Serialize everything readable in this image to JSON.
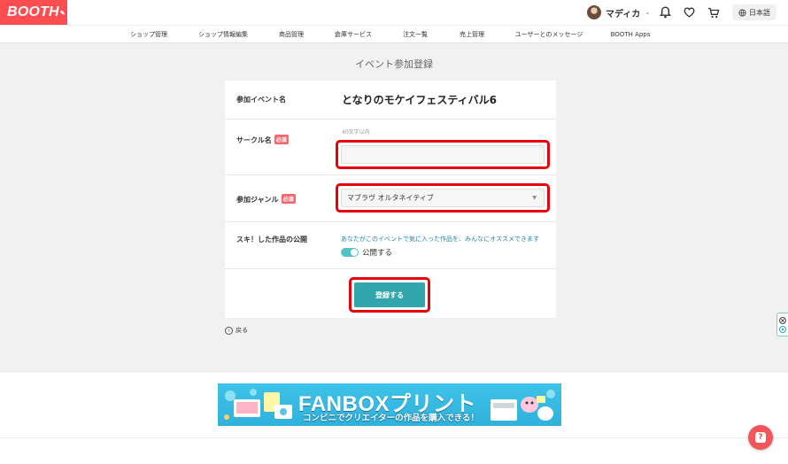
{
  "header": {
    "logo": "BOOTH",
    "logo_tag": "✎",
    "user_name": "マディカ",
    "language": "日本語"
  },
  "nav": {
    "items": [
      "ショップ管理",
      "ショップ情報編集",
      "商品管理",
      "倉庫サービス",
      "注文一覧",
      "売上管理",
      "ユーザーとのメッセージ",
      "BOOTH Apps"
    ]
  },
  "page": {
    "title": "イベント参加登録"
  },
  "form": {
    "event_label": "参加イベント名",
    "event_name": "となりのモケイフェスティバル6",
    "circle_label": "サークル名",
    "required_badge": "必須",
    "circle_hint": "40文字以内",
    "circle_value": "",
    "genre_label": "参加ジャンル",
    "genre_value": "マブラヴ オルタネイティブ",
    "favorite_label": "スキ！した作品の公開",
    "favorite_desc": "あなたがこのイベントで気に入った作品を、みんなにオススメできます",
    "toggle_label": "公開する",
    "toggle_on": true,
    "submit_label": "登録する"
  },
  "back": {
    "label": "戻る"
  },
  "banner": {
    "title": "FANBOXプリント",
    "subtitle": "コンビニでクリエイターの作品を購入できる！"
  },
  "colors": {
    "brand": "#fc4d50",
    "accent": "#31a6ad",
    "highlight": "#e8000b",
    "required": "#f4676d"
  },
  "icons": [
    "bell-icon",
    "heart-icon",
    "cart-icon",
    "globe-icon",
    "back-arrow-icon",
    "help-icon"
  ]
}
